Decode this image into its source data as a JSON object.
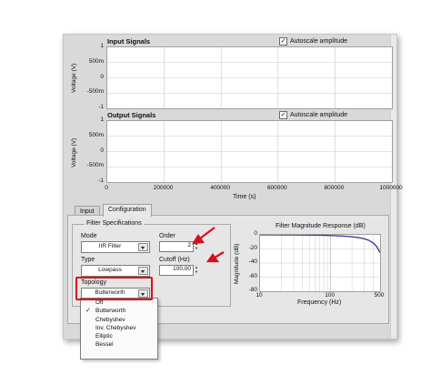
{
  "input_panel": {
    "title": "Input Signals",
    "autoscale_label": "Autoscale amplitude",
    "autoscale_checked": true,
    "ylabel": "Voltage (V)",
    "yticks": [
      "1",
      "500m",
      "0",
      "-500m",
      "-1"
    ]
  },
  "output_panel": {
    "title": "Output Signals",
    "autoscale_label": "Autoscale amplitude",
    "autoscale_checked": true,
    "ylabel": "Voltage (V)",
    "yticks": [
      "1",
      "500m",
      "0",
      "-500m",
      "-1"
    ],
    "xticks": [
      "0",
      "200000",
      "400000",
      "600000",
      "800000",
      "1000000"
    ],
    "xlabel": "Time (s)"
  },
  "tabs": [
    {
      "label": "Input",
      "active": false
    },
    {
      "label": "Configuration",
      "active": true
    }
  ],
  "filter_specs": {
    "title": "Filter Specifications",
    "mode_label": "Mode",
    "mode_value": "IIR Filter",
    "type_label": "Type",
    "type_value": "Lowpass",
    "order_label": "Order",
    "order_value": "2",
    "cutoff_label": "Cutoff (Hz)",
    "cutoff_value": "100,00",
    "topology_label": "Topology",
    "topology_value": "Butterworth"
  },
  "topology_dropdown": {
    "options": [
      "Off",
      "Butterworth",
      "Chebyshev",
      "Inv. Chebyshev",
      "Elliptic",
      "Bessel"
    ],
    "selected": "Butterworth"
  },
  "response_chart": {
    "title": "Filter Magnitude Response (dB)",
    "ylabel": "Magnitude (dB)",
    "xlabel": "Frequency (Hz)",
    "yticks": [
      "0",
      "-20",
      "-40",
      "-60",
      "-80"
    ],
    "xticks": [
      "10",
      "100",
      "500"
    ]
  },
  "chart_data": {
    "type": "line",
    "title": "Filter Magnitude Response (dB)",
    "xlabel": "Frequency (Hz)",
    "ylabel": "Magnitude (dB)",
    "xscale": "log",
    "xlim": [
      10,
      500
    ],
    "ylim": [
      -80,
      0
    ],
    "grid": true,
    "x": [
      10,
      30,
      60,
      100,
      150,
      200,
      250,
      300,
      350,
      400,
      450,
      500
    ],
    "y": [
      0,
      -0.1,
      -0.4,
      -1,
      -1.8,
      -2.7,
      -4,
      -5.6,
      -8,
      -11.5,
      -17,
      -25
    ]
  },
  "colors": {
    "annotation_red": "#d7111b",
    "response_line": "#3a2a9a"
  }
}
